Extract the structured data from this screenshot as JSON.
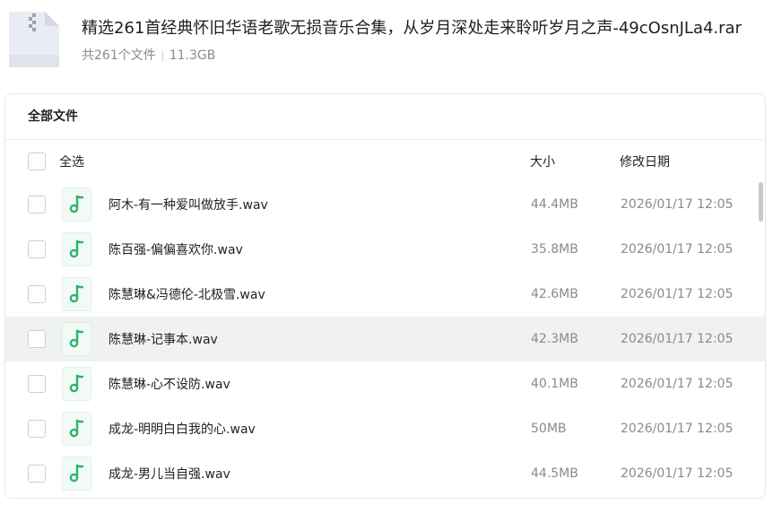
{
  "header": {
    "title": "精选261首经典怀旧华语老歌无损音乐合集，从岁月深处走来聆听岁月之声-49cOsnJLa4.rar",
    "file_count": "共261个文件",
    "total_size": "11.3GB",
    "icon": "archive-zip-icon"
  },
  "panel": {
    "title": "全部文件",
    "select_all_label": "全选",
    "col_size": "大小",
    "col_date": "修改日期"
  },
  "files": [
    {
      "name": "阿木-有一种爱叫做放手.wav",
      "size": "44.4MB",
      "date": "2026/01/17 12:05"
    },
    {
      "name": "陈百强-偏偏喜欢你.wav",
      "size": "35.8MB",
      "date": "2026/01/17 12:05"
    },
    {
      "name": "陈慧琳&冯德伦-北极雪.wav",
      "size": "42.6MB",
      "date": "2026/01/17 12:05"
    },
    {
      "name": "陈慧琳-记事本.wav",
      "size": "42.3MB",
      "date": "2026/01/17 12:05"
    },
    {
      "name": "陈慧琳-心不设防.wav",
      "size": "40.1MB",
      "date": "2026/01/17 12:05"
    },
    {
      "name": "成龙-明明白白我的心.wav",
      "size": "50MB",
      "date": "2026/01/17 12:05"
    },
    {
      "name": "成龙-男儿当自强.wav",
      "size": "44.5MB",
      "date": "2026/01/17 12:05"
    }
  ],
  "colors": {
    "music_icon_green": "#2fb36c",
    "row_hover": "#f0f1f3"
  }
}
